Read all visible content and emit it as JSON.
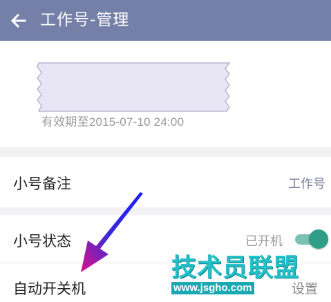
{
  "app_bar": {
    "title": "工作号-管理",
    "back_icon": "arrow-left-icon",
    "background": "#7580a8"
  },
  "account_card": {
    "expiry_text": "有效期至2015-07-10 24:00"
  },
  "settings": {
    "alias": {
      "label": "小号备注",
      "value": "工作号"
    },
    "status": {
      "label": "小号状态",
      "value": "已开机",
      "toggle_on": true,
      "toggle_color": "#2e9e88"
    },
    "auto_power": {
      "label": "自动开关机",
      "value_partial": "设置"
    }
  },
  "watermark": {
    "title": "技术员联盟",
    "url": "www.jsgho.com"
  }
}
